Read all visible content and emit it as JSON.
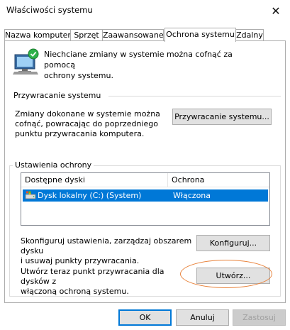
{
  "window": {
    "title": "Właściwości systemu",
    "close_glyph": "✕"
  },
  "tabs": [
    {
      "label": "Nazwa komputera",
      "active": false
    },
    {
      "label": "Sprzęt",
      "active": false
    },
    {
      "label": "Zaawansowane",
      "active": false
    },
    {
      "label": "Ochrona systemu",
      "active": true
    },
    {
      "label": "Zdalny",
      "active": false
    }
  ],
  "intro": {
    "text_line1": "Niechciane zmiany w systemie można cofnąć za pomocą",
    "text_line2": "ochrony systemu.",
    "icon": "system-protection-icon"
  },
  "restore_section": {
    "heading": "Przywracanie systemu",
    "desc_line1": "Zmiany dokonane w systemie można",
    "desc_line2": "cofnąć, powracając do poprzedniego",
    "desc_line3": "punktu przywracania komputera.",
    "button_label": "Przywracanie systemu..."
  },
  "protection_section": {
    "heading": "Ustawienia ochrony",
    "columns": [
      "Dostępne dyski",
      "Ochrona"
    ],
    "rows": [
      {
        "drive": "Dysk lokalny (C:) (System)",
        "protection": "Włączona",
        "selected": true,
        "icon": "drive-icon"
      }
    ],
    "configure_text_line1": "Skonfiguruj ustawienia, zarządzaj obszarem dysku",
    "configure_text_line2": "i usuwaj punkty przywracania.",
    "configure_button": "Konfiguruj...",
    "create_text_line1": "Utwórz teraz punkt przywracania dla dysków z",
    "create_text_line2": "włączoną ochroną systemu.",
    "create_button": "Utwórz..."
  },
  "footer": {
    "ok": "OK",
    "cancel": "Anuluj",
    "apply": "Zastosuj"
  },
  "colors": {
    "selection": "#0078d7",
    "highlight_oval": "#e8823a",
    "button_face": "#e1e1e1"
  }
}
